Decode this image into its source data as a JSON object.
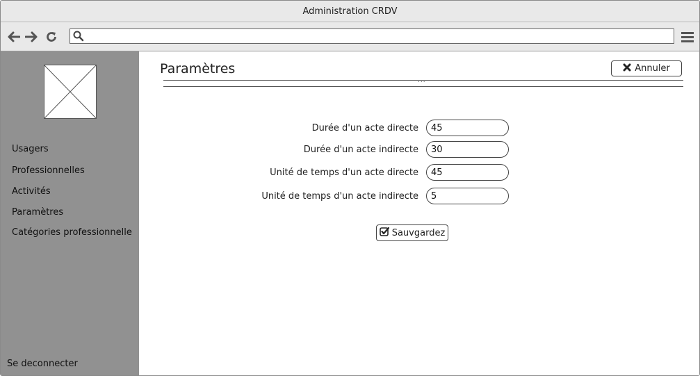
{
  "window": {
    "title": "Administration CRDV"
  },
  "toolbar": {
    "address_value": "",
    "icons": [
      "back-arrow-icon",
      "forward-arrow-icon",
      "reload-icon",
      "search-icon",
      "hamburger-menu-icon"
    ]
  },
  "sidebar": {
    "items": [
      {
        "label": "Usagers"
      },
      {
        "label": "Professionnelles"
      },
      {
        "label": "Activités"
      },
      {
        "label": "Paramètres"
      },
      {
        "label": "Catégories professionnelle"
      }
    ],
    "logout_label": "Se deconnecter"
  },
  "main": {
    "title": "Paramètres",
    "cancel_label": "Annuler",
    "divider_dots": "...",
    "fields": [
      {
        "label": "Durée d'un acte directe",
        "value": "45"
      },
      {
        "label": "Durée d'un acte indirecte",
        "value": "30"
      },
      {
        "label": "Unité de temps d'un acte directe",
        "value": "45"
      },
      {
        "label": "Unité de temps d'un acte indirecte",
        "value": "5"
      }
    ],
    "save_label": "Sauvgardez"
  },
  "colors": {
    "sidebar_bg": "#919191",
    "chrome_bg": "#e9e9e9",
    "border": "#444444"
  }
}
